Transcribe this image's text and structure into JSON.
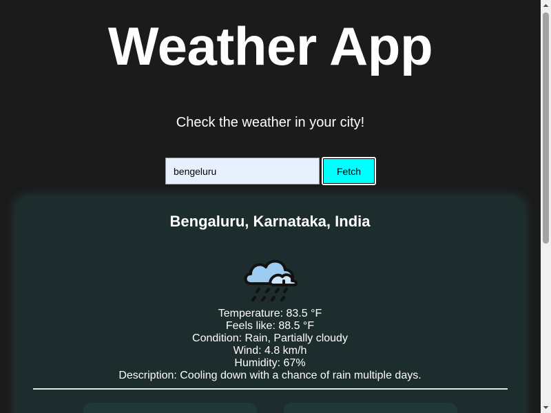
{
  "header": {
    "title": "Weather App",
    "subtitle": "Check the weather in your city!"
  },
  "search": {
    "value": "bengeluru",
    "button_label": "Fetch"
  },
  "weather": {
    "location": "Bengaluru, Karnataka, India",
    "icon": "rain-cloud-icon",
    "temperature": "Temperature: 83.5 °F",
    "feels_like": "Feels like: 88.5 °F",
    "condition": "Condition: Rain, Partially cloudy",
    "wind": "Wind: 4.8 km/h",
    "humidity": "Humidity: 67%",
    "description": "Description: Cooling down with a chance of rain multiple days."
  },
  "colors": {
    "background": "#1b1b1b",
    "accent": "#00ffff",
    "card": "#1d2c2c",
    "input_bg": "#e8f0fe"
  }
}
